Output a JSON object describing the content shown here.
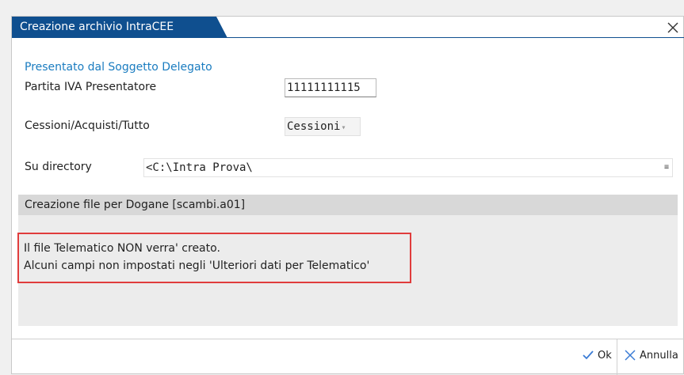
{
  "dialog": {
    "title": "Creazione archivio IntraCEE"
  },
  "section": {
    "title": "Presentato dal Soggetto Delegato"
  },
  "fields": {
    "piva_label": "Partita IVA Presentatore",
    "piva_value": "11111111115",
    "mode_label": "Cessioni/Acquisti/Tutto",
    "mode_value": "Cessioni",
    "dir_label": "Su directory",
    "dir_value": "<C:\\Intra Prova\\"
  },
  "status": {
    "text": "Creazione file per Dogane [scambi.a01]"
  },
  "message": {
    "line1": "Il file Telematico NON verra' creato.",
    "line2": "Alcuni campi non impostati negli 'Ulteriori dati per Telematico'"
  },
  "buttons": {
    "ok_label": "Ok",
    "cancel_label": "Annulla"
  },
  "colors": {
    "title_bg": "#0f4f8f",
    "section_title": "#1a7cc0",
    "highlight_border": "#e03c3c",
    "ok_icon": "#3a7bd5"
  }
}
